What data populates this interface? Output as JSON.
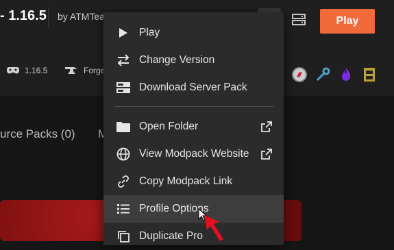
{
  "header": {
    "title": "- 1.16.5",
    "author": "by ATMTea",
    "play_label": "Play"
  },
  "meta": {
    "version": "1.16.5",
    "loader": "Forge"
  },
  "tabs": {
    "resource_packs": "urce Packs  (0)",
    "next_tab_partial": "M"
  },
  "menu": {
    "items": [
      {
        "label": "Play",
        "icon": "play-icon"
      },
      {
        "label": "Change Version",
        "icon": "swap-icon"
      },
      {
        "label": "Download Server Pack",
        "icon": "server-icon"
      },
      {
        "label": "Open Folder",
        "icon": "folder-icon",
        "external": true
      },
      {
        "label": "View Modpack Website",
        "icon": "globe-icon",
        "external": true
      },
      {
        "label": "Copy Modpack Link",
        "icon": "link-icon"
      },
      {
        "label": "Profile Options",
        "icon": "list-icon"
      },
      {
        "label": "Duplicate Pro",
        "icon": "duplicate-icon"
      }
    ],
    "active_item": "Profile Options"
  },
  "colors": {
    "accent": "#f06a3a",
    "background": "#161616",
    "menu_bg": "#2b2b2b",
    "menu_hover": "#3d3d3d"
  }
}
